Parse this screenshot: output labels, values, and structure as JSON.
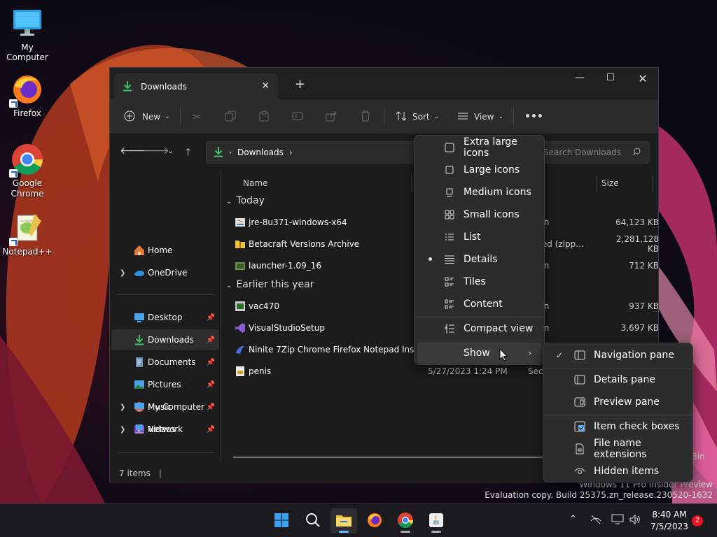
{
  "desktop": {
    "icons": [
      {
        "label": "My Computer"
      },
      {
        "label": "Firefox"
      },
      {
        "label": "Google\nChrome"
      },
      {
        "label": "Notepad++"
      }
    ]
  },
  "window": {
    "tab_title": "Downloads",
    "toolbar": {
      "new_label": "New",
      "sort_label": "Sort",
      "view_label": "View",
      "more_label": "•••"
    },
    "address": {
      "path": "Downloads",
      "search_placeholder": "Search Downloads"
    },
    "sidebar": {
      "items": [
        {
          "label": "Home"
        },
        {
          "label": "OneDrive"
        },
        {
          "label": "Desktop"
        },
        {
          "label": "Downloads"
        },
        {
          "label": "Documents"
        },
        {
          "label": "Pictures"
        },
        {
          "label": "Music"
        },
        {
          "label": "Videos"
        },
        {
          "label": "My Computer"
        },
        {
          "label": "Network"
        }
      ]
    },
    "columns": {
      "name": "Name",
      "size": "Size"
    },
    "groups": {
      "today": "Today",
      "earlier": "Earlier this year"
    },
    "files": [
      {
        "name": "jre-8u371-windows-x64",
        "date": "",
        "type": "ation",
        "size": "64,123 KB"
      },
      {
        "name": "Betacraft Versions Archive",
        "date": "",
        "type": "essed (zipp...",
        "size": "2,281,128 KB"
      },
      {
        "name": "launcher-1.09_16",
        "date": "",
        "type": "ation",
        "size": "712 KB"
      },
      {
        "name": "vac470",
        "date": "",
        "type": "ation",
        "size": "937 KB"
      },
      {
        "name": "VisualStudioSetup",
        "date": "",
        "type": "ation",
        "size": "3,697 KB"
      },
      {
        "name": "Ninite 7Zip Chrome Firefox Notepad Inst...",
        "date": "",
        "type": "",
        "size": ""
      },
      {
        "name": "penis",
        "date": "5/27/2023 1:24 PM",
        "type": "Securit",
        "size": ""
      }
    ],
    "status": "7 items"
  },
  "view_menu": {
    "items": [
      {
        "label": "Extra large icons"
      },
      {
        "label": "Large icons"
      },
      {
        "label": "Medium icons"
      },
      {
        "label": "Small icons"
      },
      {
        "label": "List"
      },
      {
        "label": "Details",
        "selected": true
      },
      {
        "label": "Tiles"
      },
      {
        "label": "Content"
      },
      {
        "label": "Compact view"
      },
      {
        "label": "Show"
      }
    ]
  },
  "show_submenu": {
    "items": [
      {
        "label": "Navigation pane",
        "checked": true
      },
      {
        "label": "Details pane"
      },
      {
        "label": "Preview pane"
      },
      {
        "label": "Item check boxes"
      },
      {
        "label": "File name extensions"
      },
      {
        "label": "Hidden items"
      }
    ]
  },
  "watermark": {
    "line1": "Windows 11 Pro Insider Preview",
    "line2": "Evaluation copy. Build 25375.zn_release.230520-1632"
  },
  "partial_desktop_text": "3in",
  "taskbar": {
    "time": "8:40 AM",
    "date": "7/5/2023",
    "notifications": "2"
  },
  "colors": {
    "accent": "#60b6ff",
    "download_green": "#3cc46b",
    "window_bg": "#1c1c1c",
    "menu_bg": "#2c2c2c"
  }
}
